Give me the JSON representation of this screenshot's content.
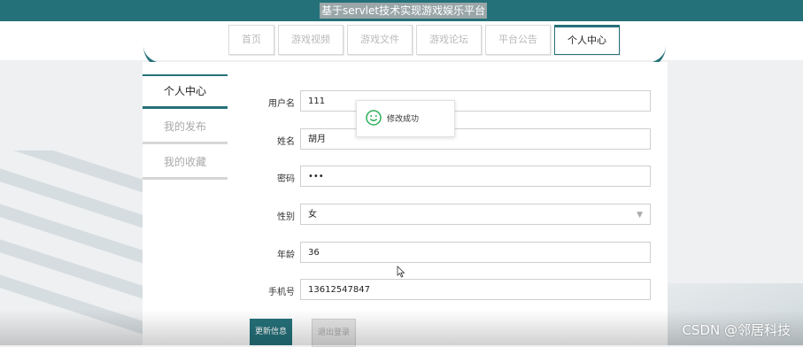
{
  "header": {
    "title": "基于servlet技术实现游戏娱乐平台"
  },
  "nav": {
    "tabs": [
      {
        "label": "首页",
        "active": false
      },
      {
        "label": "游戏视频",
        "active": false
      },
      {
        "label": "游戏文件",
        "active": false
      },
      {
        "label": "游戏论坛",
        "active": false
      },
      {
        "label": "平台公告",
        "active": false
      },
      {
        "label": "个人中心",
        "active": true
      }
    ]
  },
  "sidebar": {
    "items": [
      {
        "label": "个人中心",
        "active": true
      },
      {
        "label": "我的发布",
        "active": false
      },
      {
        "label": "我的收藏",
        "active": false
      }
    ]
  },
  "form": {
    "username": {
      "label": "用户名",
      "value": "111"
    },
    "name": {
      "label": "姓名",
      "value": "胡月"
    },
    "password": {
      "label": "密码",
      "value": "•••"
    },
    "gender": {
      "label": "性别",
      "value": "女"
    },
    "age": {
      "label": "年龄",
      "value": "36"
    },
    "phone": {
      "label": "手机号",
      "value": "13612547847"
    }
  },
  "toast": {
    "message": "修改成功",
    "icon": "smile-icon"
  },
  "buttons": {
    "update": "更新信息",
    "logout": "退出登录"
  },
  "watermark": "CSDN @邻居科技",
  "colors": {
    "accent": "#25717a"
  }
}
